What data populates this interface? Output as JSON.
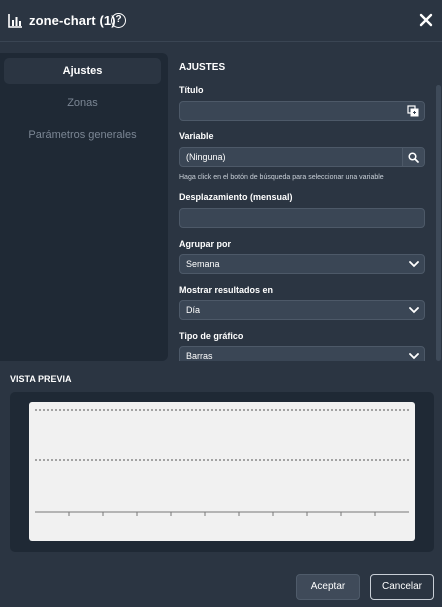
{
  "header": {
    "title": "zone-chart (1)",
    "help": "?"
  },
  "nav": {
    "items": [
      {
        "label": "Ajustes",
        "active": true
      },
      {
        "label": "Zonas",
        "active": false
      },
      {
        "label": "Parámetros generales",
        "active": false
      }
    ]
  },
  "settings": {
    "section_title": "AJUSTES",
    "titulo": {
      "label": "Título",
      "value": ""
    },
    "variable": {
      "label": "Variable",
      "value": "(Ninguna)",
      "hint": "Haga click en el botón de búsqueda para seleccionar una variable"
    },
    "desplazamiento": {
      "label": "Desplazamiento (mensual)",
      "value": ""
    },
    "agrupar": {
      "label": "Agrupar por",
      "value": "Semana"
    },
    "mostrar": {
      "label": "Mostrar resultados en",
      "value": "Día"
    },
    "tipo": {
      "label": "Tipo de gráfico",
      "value": "Barras"
    }
  },
  "preview": {
    "title": "VISTA PREVIA"
  },
  "footer": {
    "accept_label": "Aceptar",
    "cancel_label": "Cancelar"
  },
  "colors": {
    "background": "#2b3542",
    "panel": "#1f2935",
    "field": "#3a4655",
    "preview_canvas": "#f1f1f1"
  },
  "icons": [
    "chart-bar-icon",
    "help-icon",
    "close-icon",
    "copy-icon",
    "search-icon",
    "chevron-down-icon"
  ]
}
